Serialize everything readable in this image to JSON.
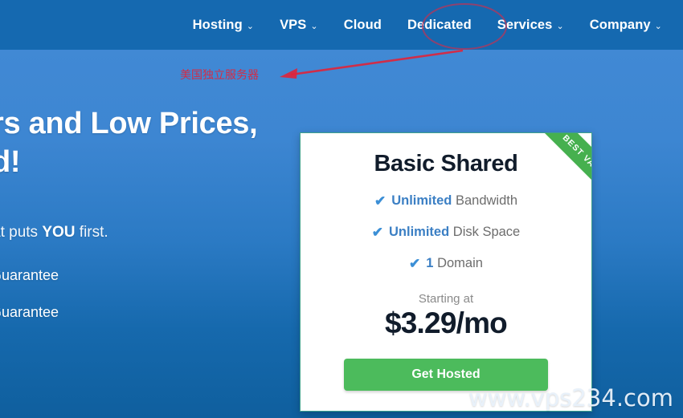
{
  "nav": {
    "items": [
      {
        "label": "Hosting",
        "has_caret": true
      },
      {
        "label": "VPS",
        "has_caret": true
      },
      {
        "label": "Cloud",
        "has_caret": false
      },
      {
        "label": "Dedicated",
        "has_caret": false
      },
      {
        "label": "Services",
        "has_caret": true
      },
      {
        "label": "Company",
        "has_caret": true
      }
    ],
    "background_color": "#1569b0",
    "text_color": "#ffffff",
    "caret_glyph": "⌄"
  },
  "hero": {
    "title": "rs and Low Prices,\nd!",
    "subtitle_prefix": "at puts ",
    "subtitle_strong": "YOU",
    "subtitle_suffix": " first.",
    "bullets": [
      "Guarantee",
      "Guarantee"
    ],
    "background_top_color": "#4189d4",
    "background_bottom_color": "#0f5f9e"
  },
  "card": {
    "title": "Basic Shared",
    "ribbon_label": "BEST VALUE",
    "ribbon_color": "#46b04f",
    "border_color": "#3fa08d",
    "check_icon_glyph": "✔",
    "check_icon_color": "#3b8fd6",
    "features": [
      {
        "strong": "Unlimited",
        "rest": " Bandwidth"
      },
      {
        "strong": "Unlimited",
        "rest": " Disk Space"
      },
      {
        "strong": "1",
        "rest": " Domain"
      }
    ],
    "price_caption": "Starting at",
    "price": "$3.29/mo",
    "cta_label": "Get Hosted",
    "cta_color": "#4cbb5c"
  },
  "annotation": {
    "text": "美国独立服务器",
    "color": "#e0243a",
    "ellipse_target": "Dedicated"
  },
  "watermark": {
    "text": "www.vps234.com"
  }
}
